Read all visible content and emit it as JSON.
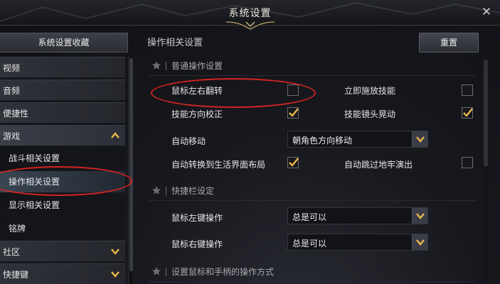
{
  "window": {
    "title": "系统设置",
    "close_glyph": "✕"
  },
  "sidebar": {
    "favorites_label": "系统设置收藏",
    "items": [
      {
        "label": "视频",
        "kind": "category"
      },
      {
        "label": "音频",
        "kind": "category"
      },
      {
        "label": "便捷性",
        "kind": "category"
      },
      {
        "label": "游戏",
        "kind": "category",
        "expanded": true,
        "icon": "chevron-up-icon"
      },
      {
        "label": "战斗相关设置",
        "kind": "sub"
      },
      {
        "label": "操作相关设置",
        "kind": "sub",
        "selected": true
      },
      {
        "label": "显示相关设置",
        "kind": "sub"
      },
      {
        "label": "铭牌",
        "kind": "sub"
      },
      {
        "label": "社区",
        "kind": "category",
        "icon": "chevron-down-icon"
      },
      {
        "label": "快捷键",
        "kind": "category",
        "icon": "chevron-down-icon"
      }
    ]
  },
  "main": {
    "title": "操作相关设置",
    "reset_label": "重置",
    "sections": [
      {
        "title": "普通操作设置",
        "settings": [
          {
            "label": "鼠标左右翻转",
            "checked": false
          },
          {
            "label": "立即施放技能",
            "checked": false
          },
          {
            "label": "技能方向校正",
            "checked": true
          },
          {
            "label": "技能镜头晃动",
            "checked": true
          },
          {
            "label": "自动移动",
            "dropdown_value": "朝角色方向移动"
          },
          {
            "label": "自动转换到生活界面布局",
            "checked": true
          },
          {
            "label": "自动跳过地牢演出",
            "checked": false
          }
        ]
      },
      {
        "title": "快捷栏设定",
        "settings": [
          {
            "label": "鼠标左键操作",
            "dropdown_value": "总是可以"
          },
          {
            "label": "鼠标右键操作",
            "dropdown_value": "总是可以"
          }
        ]
      },
      {
        "title": "设置鼠标和手柄的操作方式",
        "settings": []
      }
    ]
  },
  "colors": {
    "accent_check": "#e8b84a",
    "highlight_oval": "#d32424",
    "selected_row": "#3a4552"
  }
}
